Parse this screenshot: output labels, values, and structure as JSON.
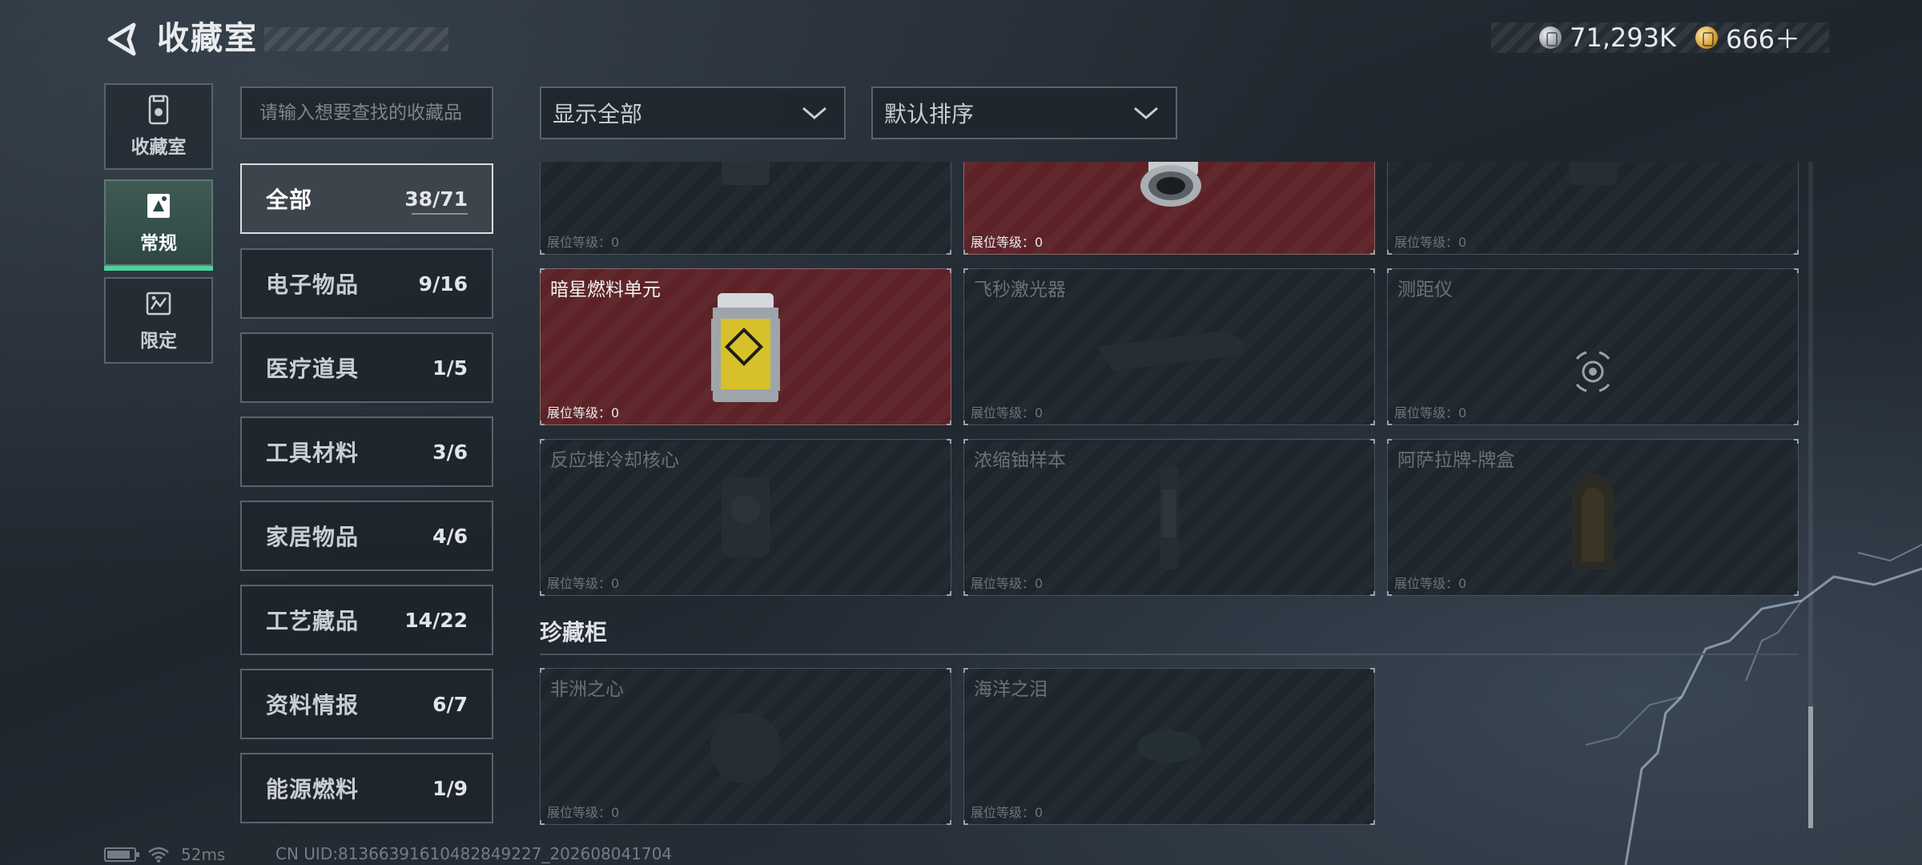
{
  "header": {
    "title": "收藏室",
    "currency": [
      {
        "icon": "silver-coin-icon",
        "value": "71,293K"
      },
      {
        "icon": "gold-coin-icon",
        "value": "666＋"
      }
    ]
  },
  "side_tabs": [
    {
      "label": "收藏室",
      "icon": "collection-room-icon",
      "active": false
    },
    {
      "label": "常规",
      "icon": "regular-icon",
      "active": true
    },
    {
      "label": "限定",
      "icon": "limited-icon",
      "active": false
    }
  ],
  "search": {
    "placeholder": "请输入想要查找的收藏品",
    "value": ""
  },
  "categories": [
    {
      "name": "全部",
      "count": "38/71",
      "active": true
    },
    {
      "name": "电子物品",
      "count": "9/16"
    },
    {
      "name": "医疗道具",
      "count": "1/5"
    },
    {
      "name": "工具材料",
      "count": "3/6"
    },
    {
      "name": "家居物品",
      "count": "4/6"
    },
    {
      "name": "工艺藏品",
      "count": "14/22"
    },
    {
      "name": "资料情报",
      "count": "6/7"
    },
    {
      "name": "能源燃料",
      "count": "1/9"
    }
  ],
  "filters": {
    "show": "显示全部",
    "sort": "默认排序"
  },
  "level_label": "展位等级：0",
  "items": [
    {
      "name": "",
      "owned": false,
      "icon": "relic-icon"
    },
    {
      "name": "",
      "owned": true,
      "icon": "canister-icon"
    },
    {
      "name": "",
      "owned": false,
      "icon": "box-icon"
    },
    {
      "name": "暗星燃料单元",
      "owned": true,
      "icon": "fuel-cell-icon"
    },
    {
      "name": "飞秒激光器",
      "owned": false,
      "icon": "laser-icon"
    },
    {
      "name": "测距仪",
      "owned": false,
      "icon": "rangefinder-icon"
    },
    {
      "name": "反应堆冷却核心",
      "owned": false,
      "icon": "reactor-core-icon"
    },
    {
      "name": "浓缩铀样本",
      "owned": false,
      "icon": "uranium-icon"
    },
    {
      "name": "阿萨拉牌-牌盒",
      "owned": false,
      "icon": "card-box-icon"
    }
  ],
  "section2": {
    "title": "珍藏柜",
    "items": [
      {
        "name": "非洲之心",
        "owned": false,
        "icon": "gem-icon"
      },
      {
        "name": "海洋之泪",
        "owned": false,
        "icon": "teardrop-gem-icon"
      }
    ]
  },
  "status": {
    "ping": "52ms",
    "uid": "CN UID:81366391610482849227_202608041704"
  }
}
